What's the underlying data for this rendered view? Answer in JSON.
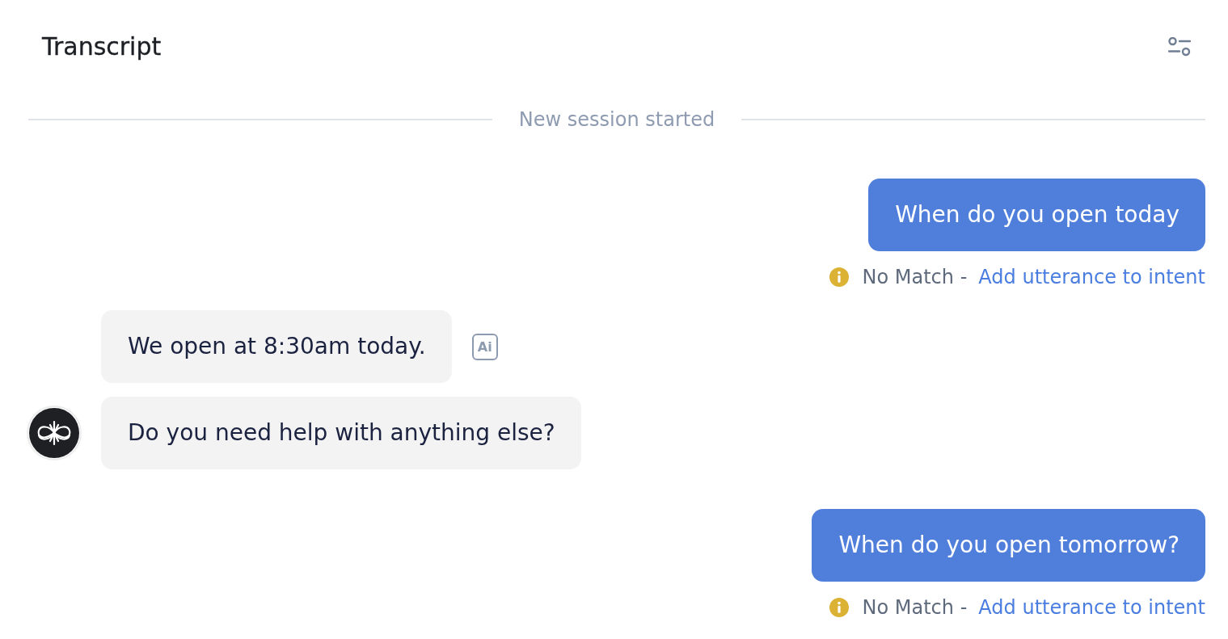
{
  "header": {
    "title": "Transcript"
  },
  "divider": {
    "label": "New session started"
  },
  "messages": [
    {
      "kind": "user",
      "text": "When do you open today",
      "status": {
        "label": "No Match -",
        "link": "Add utterance to intent"
      }
    },
    {
      "kind": "bot",
      "text": "We open at 8:30am today.",
      "tag": "Ai",
      "avatar": false
    },
    {
      "kind": "bot",
      "text": "Do you need help with anything else?",
      "avatar": true
    },
    {
      "kind": "user",
      "text": "When do you open tomorrow?",
      "status": {
        "label": "No Match -",
        "link": "Add utterance to intent"
      }
    }
  ]
}
